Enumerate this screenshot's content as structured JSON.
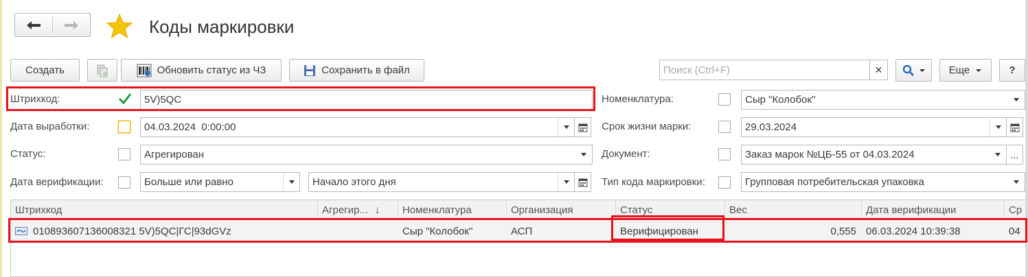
{
  "window": {
    "title": "Коды маркировки"
  },
  "toolbar": {
    "create_label": "Создать",
    "refresh_status_label": "Обновить статус из ЧЗ",
    "save_file_label": "Сохранить в файл",
    "search_placeholder": "Поиск (Ctrl+F)",
    "clear_search": "×",
    "more_label": "Еще",
    "help_label": "?"
  },
  "filters": {
    "barcode": {
      "label": "Штрихкод:",
      "checked": true,
      "value": "5V)5QC"
    },
    "production_date": {
      "label": "Дата выработки:",
      "checked": false,
      "value": "04.03.2024  0:00:00"
    },
    "status": {
      "label": "Статус:",
      "checked": false,
      "value": "Агрегирован"
    },
    "verification_date": {
      "label": "Дата верификации:",
      "checked": false,
      "condition": "Больше или равно",
      "value": "Начало этого дня"
    },
    "nomenclature": {
      "label": "Номенклатура:",
      "checked": false,
      "value": "Сыр \"Колобок\""
    },
    "mark_lifetime": {
      "label": "Срок жизни марки:",
      "checked": false,
      "value": "29.03.2024"
    },
    "document": {
      "label": "Документ:",
      "checked": false,
      "value": "Заказ марок №ЦБ-55 от 04.03.2024",
      "more": "..."
    },
    "mark_code_type": {
      "label": "Тип кода маркировки:",
      "checked": false,
      "value": "Групповая потребительская упаковка"
    }
  },
  "table": {
    "columns": [
      "Штрихкод",
      "Агрегир...",
      "Номенклатура",
      "Организация",
      "Статус",
      "Вес",
      "Дата верификации",
      "Ср"
    ],
    "sort_indicator": "↓",
    "rows": [
      {
        "barcode": "010893607136008321 5V)5QC|ГС|93dGVz",
        "aggregated": "",
        "nomenclature": "Сыр \"Колобок\"",
        "organization": "АСП",
        "status": "Верифицирован",
        "weight": "0,555",
        "verification_date": "06.03.2024 10:39:38",
        "extra": "04"
      }
    ]
  },
  "colors": {
    "highlight": "#e8121c",
    "star": "#f5c400",
    "search_icon": "#2f6fb8"
  }
}
